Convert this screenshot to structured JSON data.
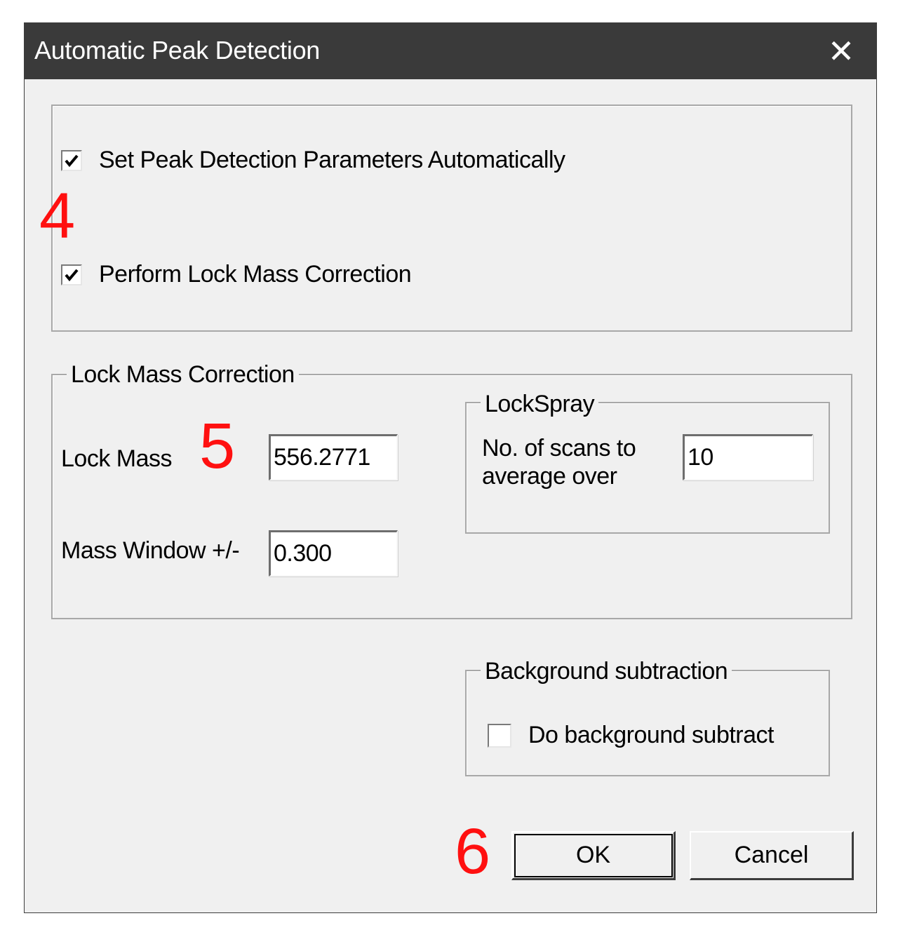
{
  "dialog": {
    "title": "Automatic Peak Detection",
    "close_glyph": "✕"
  },
  "options": {
    "auto_params": {
      "label": "Set Peak Detection Parameters Automatically",
      "checked": true
    },
    "lock_mass_correction": {
      "label": "Perform Lock Mass Correction",
      "checked": true
    }
  },
  "lock_mass_group": {
    "legend": "Lock Mass Correction",
    "lock_mass_label": "Lock Mass",
    "lock_mass_value": "556.2771",
    "mass_window_label": "Mass Window +/-",
    "mass_window_value": "0.300",
    "lockspray": {
      "legend": "LockSpray",
      "scans_label_line1": "No. of scans to",
      "scans_label_line2": "average over",
      "scans_value": "10"
    }
  },
  "background_group": {
    "legend": "Background subtraction",
    "checkbox_label": "Do background subtract",
    "checked": false
  },
  "buttons": {
    "ok": "OK",
    "cancel": "Cancel"
  },
  "annotations": {
    "a4": "4",
    "a5": "5",
    "a6": "6"
  },
  "colors": {
    "titlebar": "#3a3a3a",
    "annotation": "#ff1010",
    "dialog_bg": "#f0f0f0"
  }
}
